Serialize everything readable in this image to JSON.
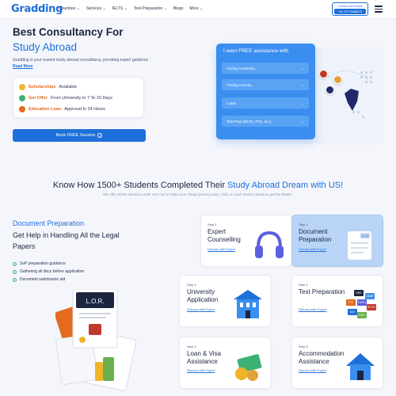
{
  "nav": {
    "logo": "Gradding",
    "links": [
      "Countries ⌄",
      "Services ⌄",
      "IELTS ⌄",
      "Test Preparation ⌄",
      "Blogs",
      "More ⌄"
    ],
    "cta_label": "Connect with Expert",
    "cta_phone": "+91 9773168670"
  },
  "hero": {
    "title_line1": "Best Consultancy For",
    "title_line2": "Study Abroad",
    "subtitle": "Gradding is your trusted study abroad consultancy, providing expert guidance",
    "read_more": "Read More",
    "features": [
      {
        "highlight": "Scholarships",
        "text": "Available",
        "color": "#f0b429"
      },
      {
        "highlight": "Get Offer",
        "text": "From University In 7 To 15 Days",
        "color": "#3bb273"
      },
      {
        "highlight": "Education Loan",
        "text": "Approval In 24 Hours",
        "color": "#e36a1f"
      }
    ],
    "book_button": "Book FREE Session",
    "info_icon": "i"
  },
  "assist_form": {
    "title": "I want FREE assistance with",
    "items": [
      "Finding University",
      "Finding Country",
      "Loans",
      "Test Prep (IELTS, PTE, etc.)"
    ],
    "arrow": "→"
  },
  "section": {
    "title_plain": "Know How 1500+ Students Completed Their ",
    "title_highlight": "Study Abroad Dream with US!",
    "subtitle": "We offer all the services under one roof to make your dream journey easy. Click on each section below to get the details."
  },
  "doc_prep": {
    "title": "Document Preparation",
    "heading": "Get Help in Handling All the Legal Papers",
    "items": [
      "SoP preparation guidance",
      "Gathering all docs before application",
      "Document submission aid"
    ],
    "check": "✓",
    "lor_label": "L.O.R."
  },
  "steps": [
    {
      "num": "Step 1",
      "title": "Expert Counselling",
      "link": "Discuss with Expert",
      "icon": "headphones-icon"
    },
    {
      "num": "Step 2",
      "title": "Document Preparation",
      "link": "Discuss with Expert",
      "icon": "sop-document-icon"
    },
    {
      "num": "Step 3",
      "title": "University Application",
      "link": "Discuss with Expert",
      "icon": "university-building-icon"
    },
    {
      "num": "Step 4",
      "title": "Test Preparation",
      "link": "Discuss with Expert",
      "icon": "test-badges-icon"
    },
    {
      "num": "Step 5",
      "title": "Loan & Visa Assistance",
      "link": "Discuss with Expert",
      "icon": "money-icon"
    },
    {
      "num": "Step 6",
      "title": "Accommodation Assistance",
      "link": "Discuss with Expert",
      "icon": "house-icon"
    }
  ],
  "sop_label": "SOP",
  "test_badges": [
    "GRE",
    "GMAT",
    "PTE",
    "TOEFL",
    "IELTS",
    "SAT",
    "DUO"
  ],
  "colors": {
    "primary": "#1e6fd9",
    "accent": "#e36a1f",
    "form_bg": "#3a8ef0"
  }
}
